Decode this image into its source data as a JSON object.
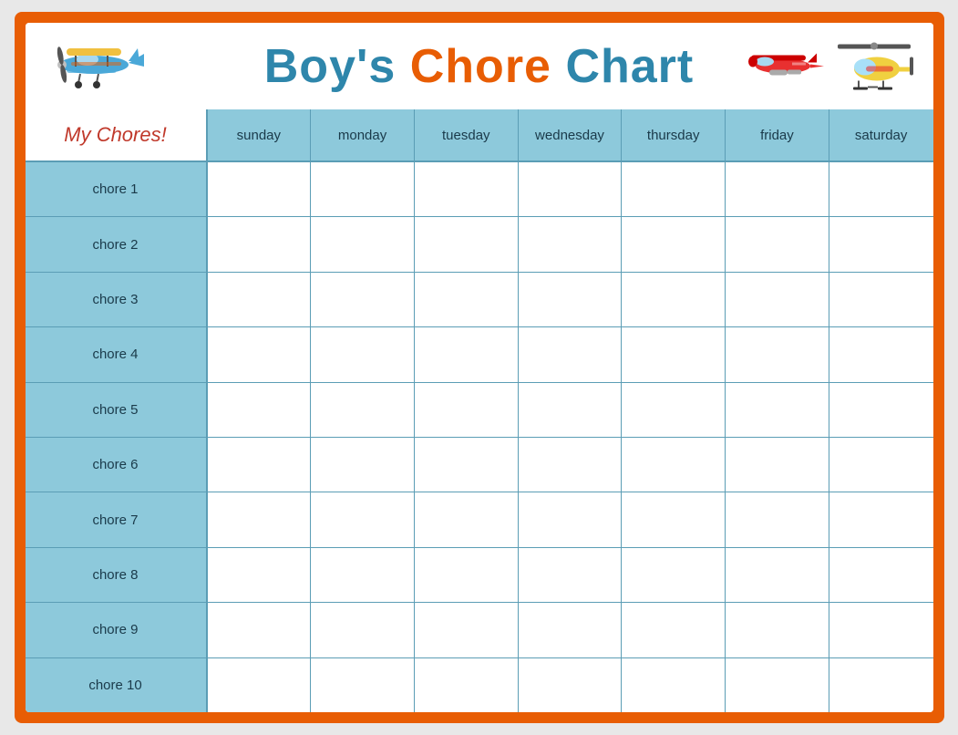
{
  "header": {
    "title_part1": "Boy's",
    "title_part2": "Chore",
    "title_part3": "Chart"
  },
  "my_chores_label": "My Chores!",
  "days": [
    "sunday",
    "monday",
    "tuesday",
    "wednesday",
    "thursday",
    "friday",
    "saturday"
  ],
  "chores": [
    "chore 1",
    "chore 2",
    "chore 3",
    "chore 4",
    "chore 5",
    "chore 6",
    "chore 7",
    "chore 8",
    "chore 9",
    "chore 10"
  ]
}
